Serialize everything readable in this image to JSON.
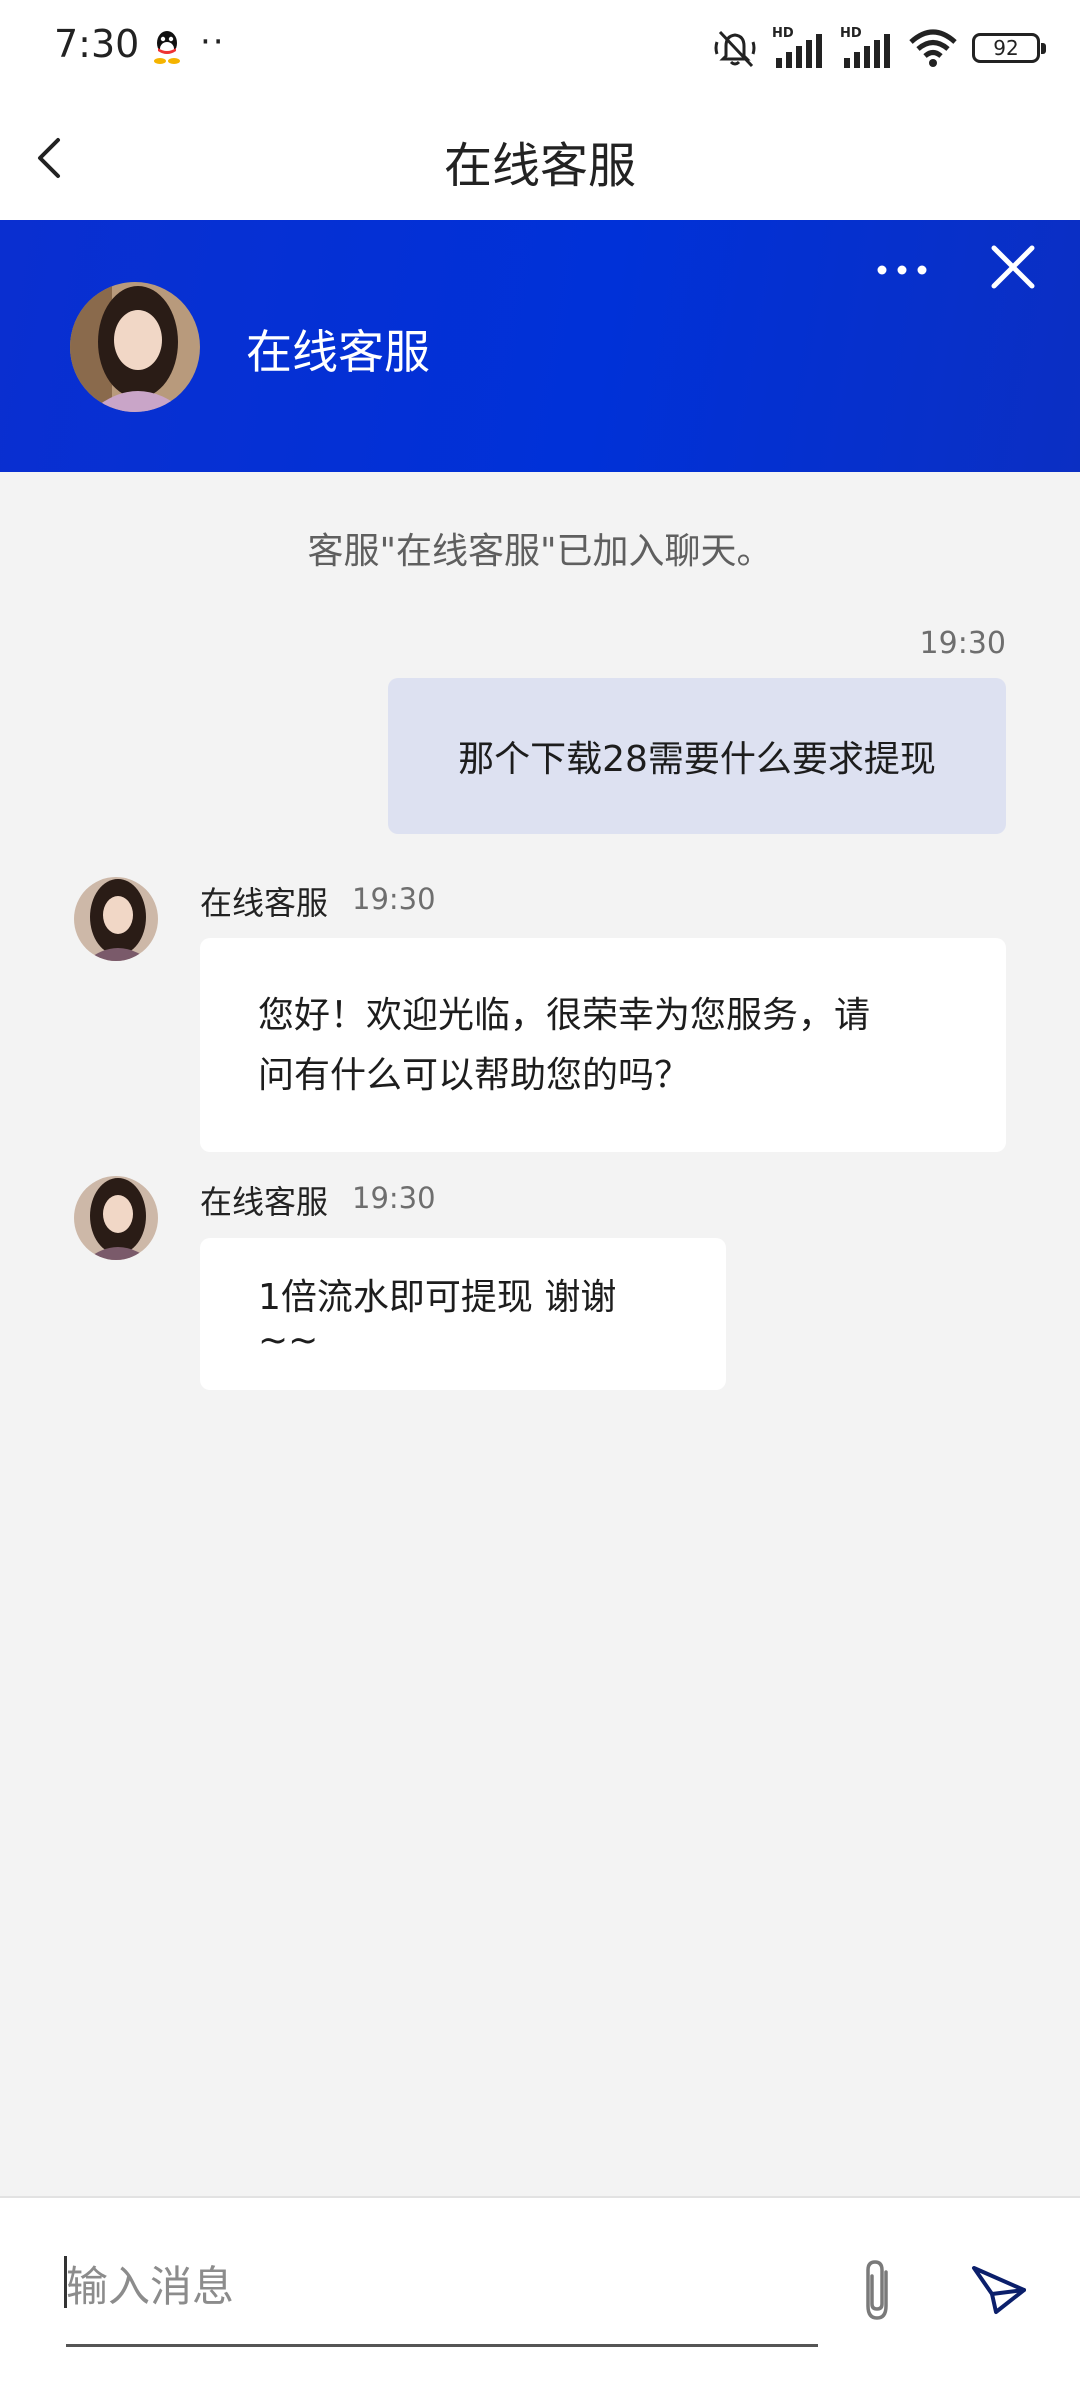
{
  "status_bar": {
    "time": "7:30",
    "dots": "··",
    "battery": "92",
    "hd_label": "HD"
  },
  "header": {
    "title": "在线客服"
  },
  "banner": {
    "agent_name": "在线客服"
  },
  "chat": {
    "system_message": "客服\"在线客服\"已加入聊天。",
    "outgoing": {
      "time": "19:30",
      "text": "那个下载28需要什么要求提现"
    },
    "incoming": [
      {
        "name": "在线客服",
        "time": "19:30",
        "lines": [
          "您好！欢迎光临，很荣幸为您服务，请",
          "问有什么可以帮助您的吗？"
        ]
      },
      {
        "name": "在线客服",
        "time": "19:30",
        "lines": [
          "1倍流水即可提现 谢谢~~"
        ]
      }
    ]
  },
  "input": {
    "placeholder": "输入消息"
  },
  "colors": {
    "brand_blue": "#0031d8",
    "outgoing_bubble": "#dde1f1",
    "background": "#f3f3f3"
  },
  "icons": [
    "back-icon",
    "more-icon",
    "close-icon",
    "attach-icon",
    "send-icon",
    "qq-icon",
    "mute-icon",
    "signal-icon",
    "wifi-icon",
    "battery-icon"
  ]
}
